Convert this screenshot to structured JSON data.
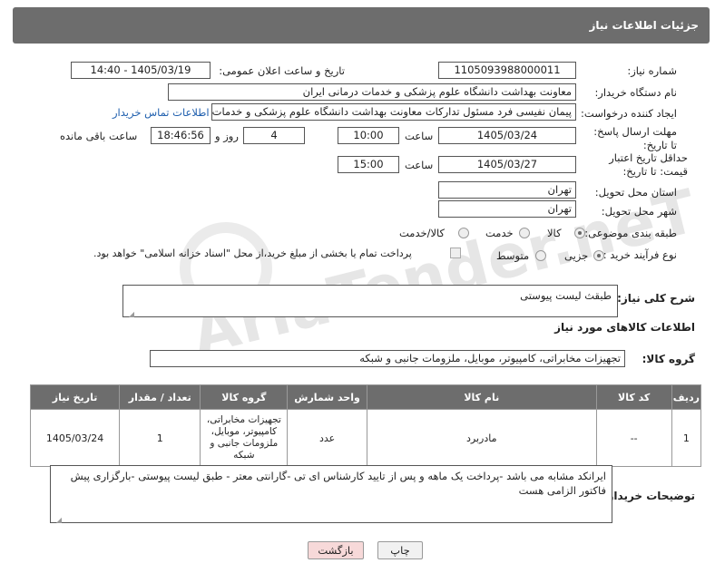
{
  "header": {
    "title": "جزئیات اطلاعات نیاز"
  },
  "fields": {
    "need_number_label": "شماره نیاز:",
    "need_number": "1105093988000011",
    "announce_label": "تاریخ و ساعت اعلان عمومی:",
    "announce_value": "1405/03/19 - 14:40",
    "buyer_org_label": "نام دستگاه خریدار:",
    "buyer_org": "معاونت بهداشت دانشگاه علوم پزشکی و خدمات درمانی ایران",
    "requester_label": "ایجاد کننده درخواست:",
    "requester": "پیمان نفیسی فرد مسئول تدارکات  معاونت بهداشت دانشگاه علوم پزشکی و خدمات درمانی ایران",
    "contact_link": "اطلاعات تماس خریدار",
    "deadline_label": "مهلت ارسال پاسخ: تا تاریخ:",
    "deadline_date": "1405/03/24",
    "time_label": "ساعت",
    "deadline_time": "10:00",
    "days_value": "4",
    "days_label": "روز و",
    "remaining_time": "18:46:56",
    "remaining_label": "ساعت باقی مانده",
    "validity_label": "حداقل تاریخ اعتبار قیمت: تا تاریخ:",
    "validity_date": "1405/03/27",
    "validity_time": "15:00",
    "province_label": "استان محل تحویل:",
    "province": "تهران",
    "city_label": "شهر محل تحویل:",
    "city": "تهران",
    "category_label": "طبقه بندی موضوعی:",
    "category_options": [
      "کالا",
      "خدمت",
      "کالا/خدمت"
    ],
    "process_label": "نوع فرآیند خرید :",
    "process_options": [
      "جزیی",
      "متوسط"
    ],
    "payment_note": "پرداخت تمام یا بخشی از مبلغ خرید،از محل \"اسناد خزانه اسلامی\" خواهد بود."
  },
  "summary": {
    "label": "شرح کلی نیاز:",
    "value": "طبقث لیست پیوستی"
  },
  "goods": {
    "section_title": "اطلاعات کالاهای مورد نیاز",
    "group_label": "گروه کالا:",
    "group_value": "تجهیزات مخابراتی، کامپیوتر، موبایل، ملزومات جانبی و شبکه",
    "table": {
      "headers": [
        "ردیف",
        "کد کالا",
        "نام کالا",
        "واحد شمارش",
        "گروه کالا",
        "تعداد / مقدار",
        "تاریخ نیاز"
      ],
      "rows": [
        [
          "1",
          "--",
          "مادربرد",
          "عدد",
          "تجهیزات مخابراتی، کامپیوتر، موبایل، ملزومات جانبی و شبکه",
          "1",
          "1405/03/24"
        ]
      ]
    }
  },
  "buyer_notes": {
    "label": "توضیحات خریدار:",
    "value": "ایرانکد مشابه می باشد -پرداخت یک ماهه و پس از تایید کارشناس ای تی -گارانتی معتر - طبق لیست پیوستی -بارگزاری پیش فاکتور الزامی هست"
  },
  "buttons": {
    "print": "چاپ",
    "back": "بازگشت"
  },
  "watermark": {
    "text": "AriaTender.neT"
  },
  "colors": {
    "header_bg": "#6d6d6d",
    "link": "#1f5fae",
    "back_btn_bg": "#f7d9d9"
  }
}
